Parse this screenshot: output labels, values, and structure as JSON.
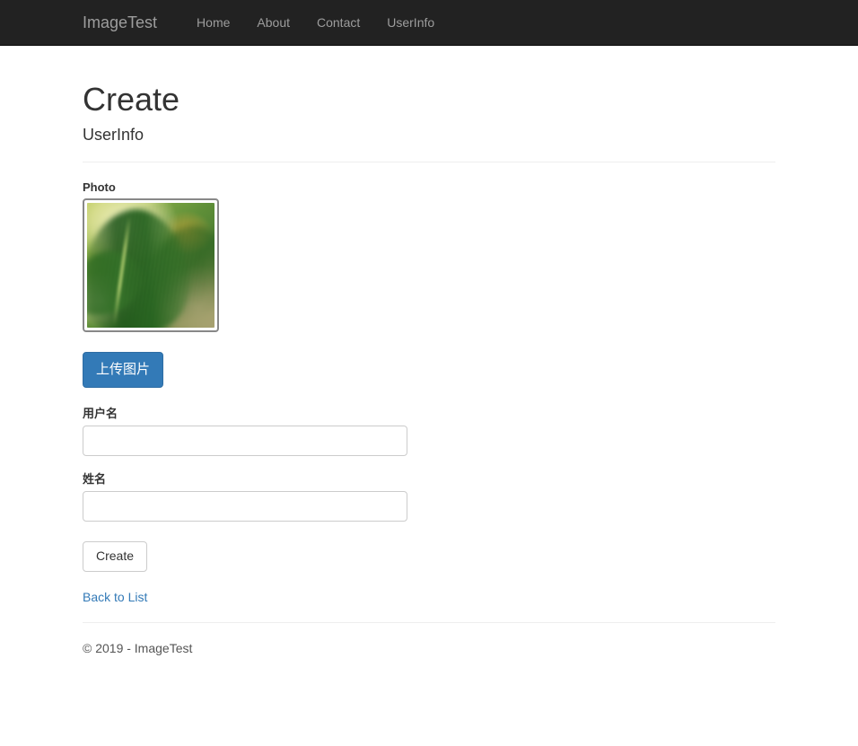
{
  "navbar": {
    "brand": "ImageTest",
    "links": [
      {
        "label": "Home"
      },
      {
        "label": "About"
      },
      {
        "label": "Contact"
      },
      {
        "label": "UserInfo"
      }
    ]
  },
  "page": {
    "title": "Create",
    "subtitle": "UserInfo"
  },
  "form": {
    "photo": {
      "label": "Photo",
      "image_alt": "blurred close-up of green palm fronds",
      "upload_button": "上传图片"
    },
    "fields": [
      {
        "label": "用户名",
        "value": "",
        "placeholder": ""
      },
      {
        "label": "姓名",
        "value": "",
        "placeholder": ""
      }
    ],
    "submit_label": "Create",
    "back_link": "Back to List"
  },
  "footer": {
    "copyright": "© 2019 - ImageTest"
  },
  "colors": {
    "navbar_bg": "#222222",
    "navbar_text": "#9d9d9d",
    "primary": "#337ab7",
    "link": "#337ab7",
    "border": "#cccccc",
    "frame_border": "#888888",
    "rule": "#eeeeee"
  }
}
